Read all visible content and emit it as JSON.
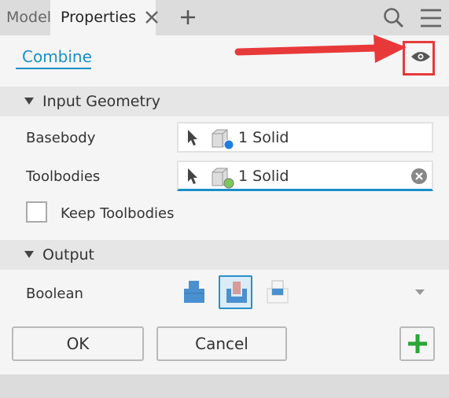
{
  "tabs": [
    {
      "label": "Model"
    },
    {
      "label": "Properties"
    }
  ],
  "header": {
    "title": "Combine"
  },
  "input_geometry": {
    "title": "Input Geometry",
    "basebody": {
      "label": "Basebody",
      "value": "1 Solid"
    },
    "toolbodies": {
      "label": "Toolbodies",
      "value": "1 Solid"
    },
    "keep_toolbodies": {
      "label": "Keep Toolbodies",
      "checked": false
    }
  },
  "output": {
    "title": "Output",
    "boolean": {
      "label": "Boolean",
      "options": [
        "join",
        "cut",
        "intersect"
      ],
      "selected": "cut"
    }
  },
  "buttons": {
    "ok": "OK",
    "cancel": "Cancel"
  },
  "colors": {
    "accent": "#1a8fc9",
    "annotation": "#e8393a",
    "apply_plus": "#2aa53a"
  }
}
